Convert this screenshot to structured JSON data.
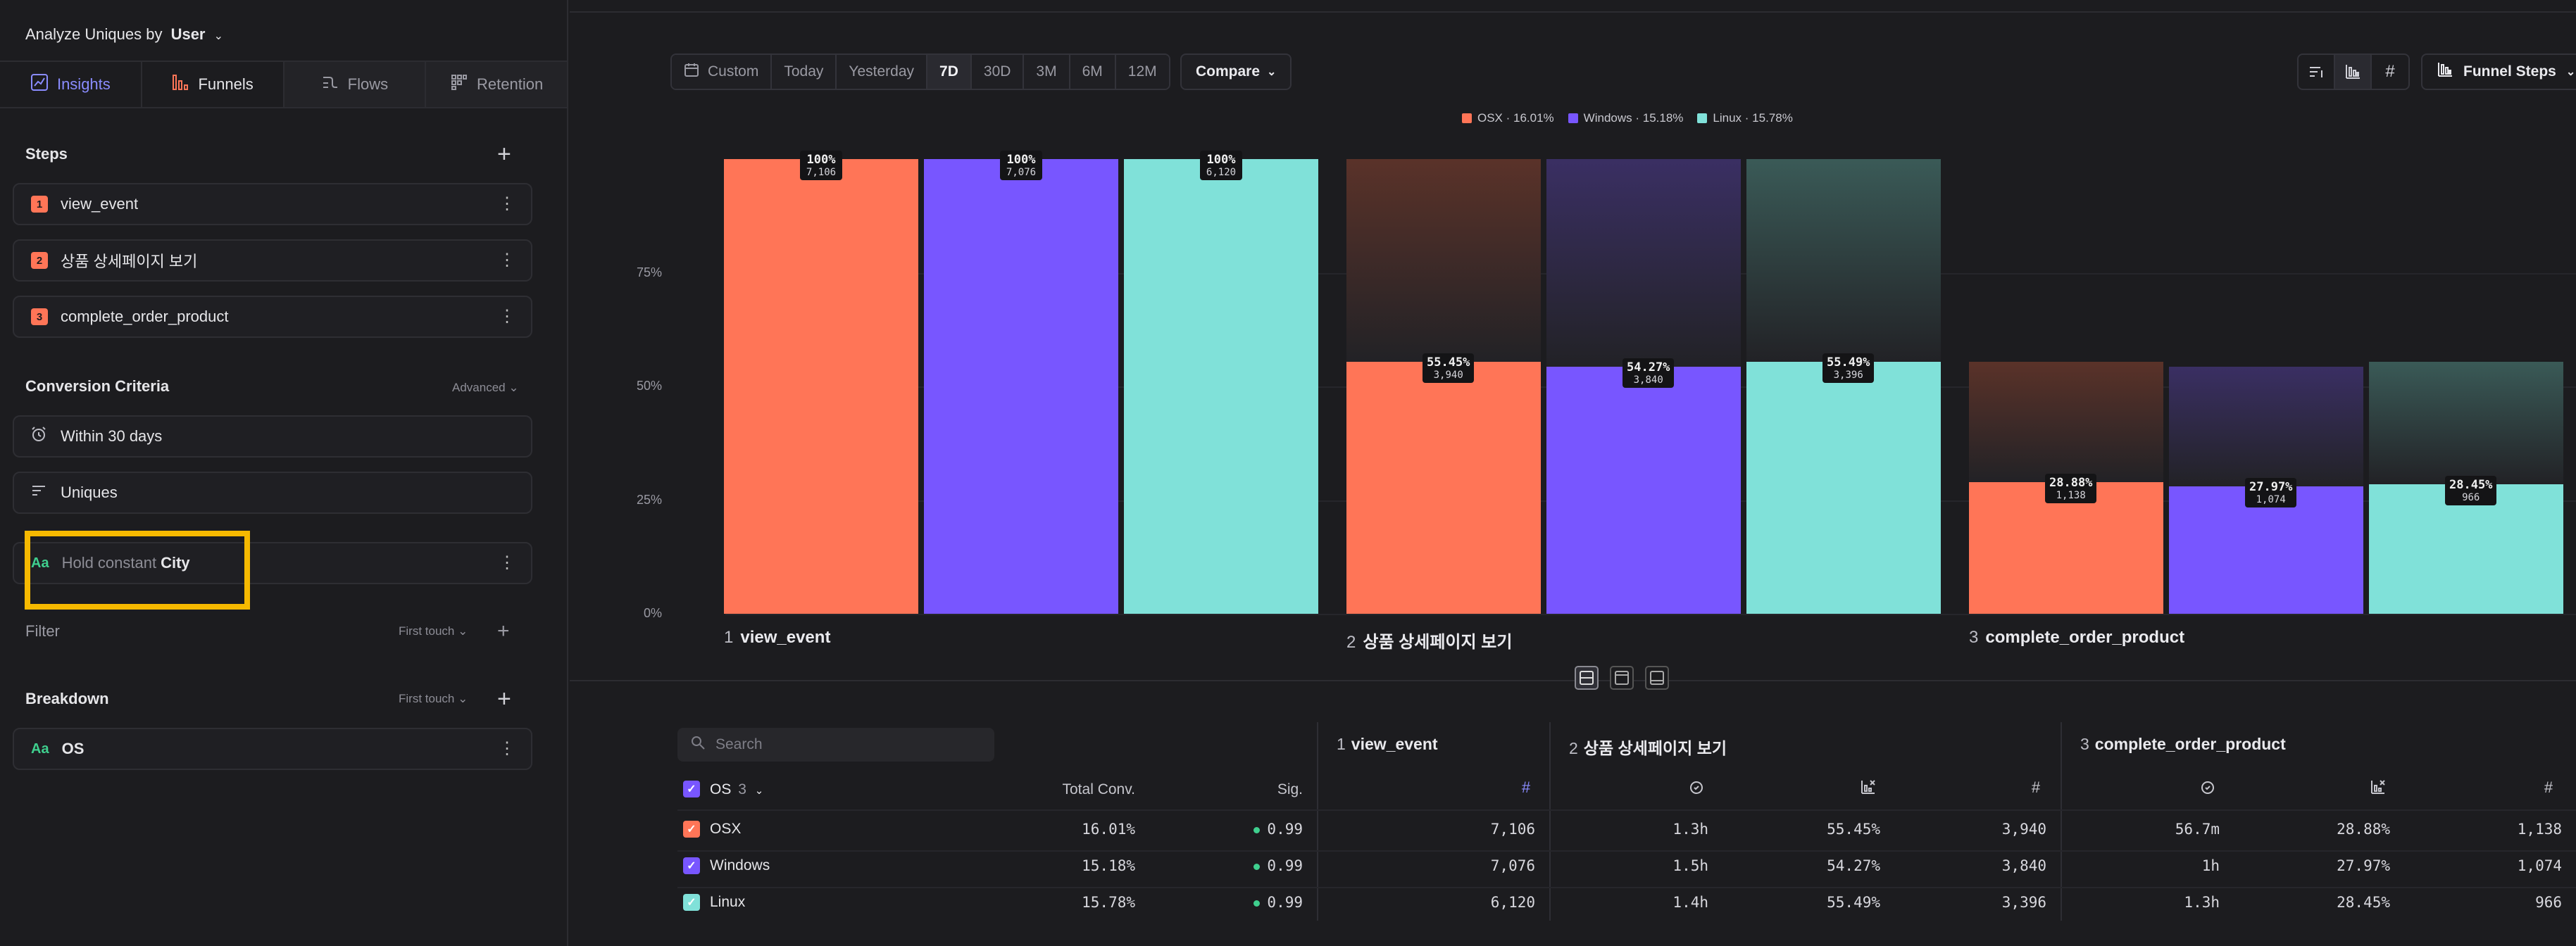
{
  "sidebar": {
    "analyze_prefix": "Analyze Uniques by",
    "analyze_value": "User",
    "tabs": [
      {
        "label": "Insights"
      },
      {
        "label": "Funnels"
      },
      {
        "label": "Flows"
      },
      {
        "label": "Retention"
      }
    ],
    "steps_title": "Steps",
    "steps": [
      {
        "num": "1",
        "label": "view_event"
      },
      {
        "num": "2",
        "label": "상품 상세페이지 보기"
      },
      {
        "num": "3",
        "label": "complete_order_product"
      }
    ],
    "conversion_title": "Conversion Criteria",
    "conversion_advanced": "Advanced",
    "window_label": "Within 30 days",
    "counting_label": "Uniques",
    "hold_aa": "Aa",
    "hold_prefix": "Hold constant",
    "hold_value": "City",
    "filter_title": "Filter",
    "filter_attr": "First touch",
    "breakdown_title": "Breakdown",
    "breakdown_attr": "First touch",
    "breakdown_aa": "Aa",
    "breakdown_value": "OS"
  },
  "toolbar": {
    "date_options": [
      "Custom",
      "Today",
      "Yesterday",
      "7D",
      "30D",
      "3M",
      "6M",
      "12M"
    ],
    "active_date": "7D",
    "compare_label": "Compare",
    "funnel_steps_label": "Funnel Steps"
  },
  "colors": {
    "osx": "#ff7557",
    "windows": "#7856ff",
    "linux": "#80e1d9"
  },
  "chart_data": {
    "type": "bar",
    "y_ticks": [
      "0%",
      "25%",
      "50%",
      "75%"
    ],
    "ylim": [
      0,
      100
    ],
    "legend": [
      {
        "name": "OSX",
        "label": "OSX · 16.01%",
        "color": "#ff7557"
      },
      {
        "name": "Windows",
        "label": "Windows · 15.18%",
        "color": "#7856ff"
      },
      {
        "name": "Linux",
        "label": "Linux · 15.78%",
        "color": "#80e1d9"
      }
    ],
    "categories": [
      {
        "num": "1",
        "label": "view_event"
      },
      {
        "num": "2",
        "label": "상품 상세페이지 보기"
      },
      {
        "num": "3",
        "label": "complete_order_product"
      }
    ],
    "series": [
      {
        "name": "OSX",
        "values": [
          100,
          55.45,
          28.88
        ],
        "labels": [
          "100%",
          "55.45%",
          "28.88%"
        ],
        "counts": [
          "7,106",
          "3,940",
          "1,138"
        ]
      },
      {
        "name": "Windows",
        "values": [
          100,
          54.27,
          27.97
        ],
        "labels": [
          "100%",
          "54.27%",
          "27.97%"
        ],
        "counts": [
          "7,076",
          "3,840",
          "1,074"
        ]
      },
      {
        "name": "Linux",
        "values": [
          100,
          55.49,
          28.45
        ],
        "labels": [
          "100%",
          "55.49%",
          "28.45%"
        ],
        "counts": [
          "6,120",
          "3,396",
          "966"
        ]
      }
    ]
  },
  "table": {
    "search_placeholder": "Search",
    "group_header": "OS",
    "group_count": "3",
    "total_conv_header": "Total Conv.",
    "sig_header": "Sig.",
    "steps": [
      {
        "num": "1",
        "label": "view_event"
      },
      {
        "num": "2",
        "label": "상품 상세페이지 보기"
      },
      {
        "num": "3",
        "label": "complete_order_product"
      }
    ],
    "rows": [
      {
        "name": "OSX",
        "total": "16.01%",
        "sig": "0.99",
        "s1": "7,106",
        "s2_time": "1.3h",
        "s2_conv": "55.45%",
        "s2_count": "3,940",
        "s3_time": "56.7m",
        "s3_conv": "28.88%",
        "s3_count": "1,138"
      },
      {
        "name": "Windows",
        "total": "15.18%",
        "sig": "0.99",
        "s1": "7,076",
        "s2_time": "1.5h",
        "s2_conv": "54.27%",
        "s2_count": "3,840",
        "s3_time": "1h",
        "s3_conv": "27.97%",
        "s3_count": "1,074"
      },
      {
        "name": "Linux",
        "total": "15.78%",
        "sig": "0.99",
        "s1": "6,120",
        "s2_time": "1.4h",
        "s2_conv": "55.49%",
        "s2_count": "3,396",
        "s3_time": "1.3h",
        "s3_conv": "28.45%",
        "s3_count": "966"
      }
    ]
  }
}
